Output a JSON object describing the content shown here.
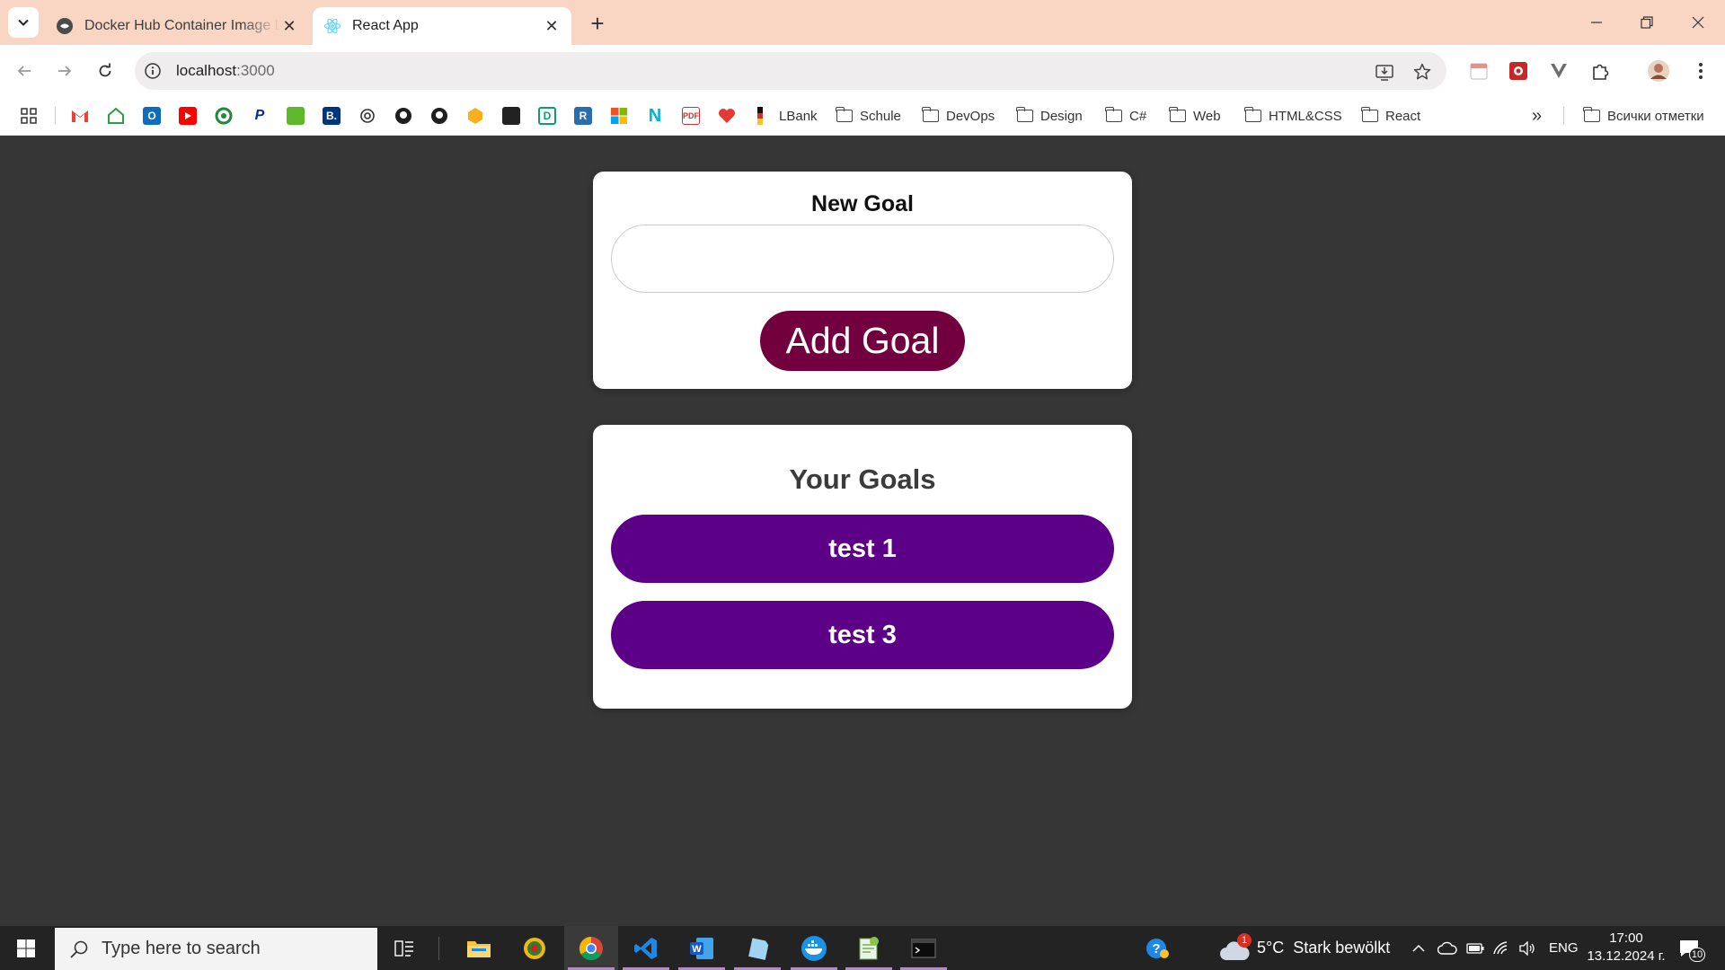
{
  "browser": {
    "tabs": [
      {
        "title": "Docker Hub Container Image Library",
        "active": false,
        "favicon": "docker-hub-icon"
      },
      {
        "title": "React App",
        "active": true,
        "favicon": "react-icon"
      }
    ],
    "url_host": "localhost",
    "url_port": ":3000",
    "bookmark_folders": [
      "LBank",
      "Schule",
      "DevOps",
      "Design",
      "C#",
      "Web",
      "HTML&CSS",
      "React"
    ],
    "all_bookmarks_label": "Всички отметки",
    "bookmark_icons": [
      "apps-icon",
      "gmail-icon",
      "home-icon",
      "outlook-icon",
      "youtube-icon",
      "refresh-green-icon",
      "paypal-icon",
      "datev-icon",
      "booking-icon",
      "chatgpt-icon",
      "github-icon",
      "github-icon-2",
      "stackblitz-icon",
      "terminal-icon",
      "datacamp-icon",
      "r-icon",
      "microsoft-icon",
      "notion-icon",
      "pdf24-icon",
      "heart-icon",
      "lbank-icon"
    ]
  },
  "app": {
    "form_label": "New Goal",
    "input_value": "",
    "input_placeholder": "",
    "add_button_label": "Add Goal",
    "goals_heading": "Your Goals",
    "goals": [
      "test 1",
      "test 3"
    ],
    "colors": {
      "background": "#363636",
      "add_button": "#72003f",
      "goal_item": "#5c0087"
    }
  },
  "taskbar": {
    "search_placeholder": "Type here to search",
    "weather": "5°C  Stark bewölkt",
    "weather_badge": "1",
    "language": "ENG",
    "time": "17:00",
    "date": "13.12.2024 г.",
    "notification_count": "10",
    "pinned_apps": [
      "task-view-icon",
      "file-explorer-icon",
      "app-green-icon",
      "chrome-icon",
      "vscode-icon",
      "word-icon",
      "notepad-icon",
      "docker-icon",
      "notepad-plus-icon",
      "terminal-icon"
    ]
  }
}
